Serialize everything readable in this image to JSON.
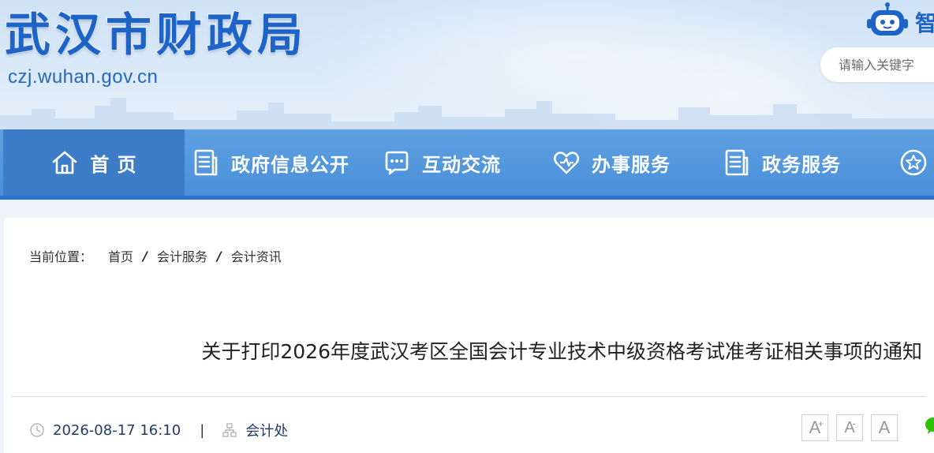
{
  "header": {
    "site_title": "武汉市财政局",
    "site_url": "czj.wuhan.gov.cn",
    "robot_label": "智",
    "search_placeholder": "请输入关键字"
  },
  "nav": {
    "items": [
      {
        "label": "首 页",
        "icon": "home-icon",
        "active": true
      },
      {
        "label": "政府信息公开",
        "icon": "document-icon"
      },
      {
        "label": "互动交流",
        "icon": "chat-icon"
      },
      {
        "label": "办事服务",
        "icon": "heart-icon"
      },
      {
        "label": "政务服务",
        "icon": "document-icon"
      },
      {
        "label": "",
        "icon": "star-icon"
      }
    ]
  },
  "breadcrumb": {
    "label": "当前位置：",
    "items": [
      "首页",
      "会计服务",
      "会计资讯"
    ],
    "separator": "/"
  },
  "article": {
    "title": "关于打印2026年度武汉考区全国会计专业技术中级资格考试准考证相关事项的通知",
    "date": "2026-08-17 16:10",
    "divider": "|",
    "source": "会计处"
  },
  "font_size_controls": {
    "increase": "A",
    "increase_mark": "+",
    "decrease": "A",
    "decrease_mark": "-",
    "reset": "A"
  },
  "colors": {
    "brand_blue": "#1e64c8",
    "nav_bg": "#4a8fd8",
    "nav_active": "#3d7cc6",
    "share_green": "#2dc100"
  }
}
